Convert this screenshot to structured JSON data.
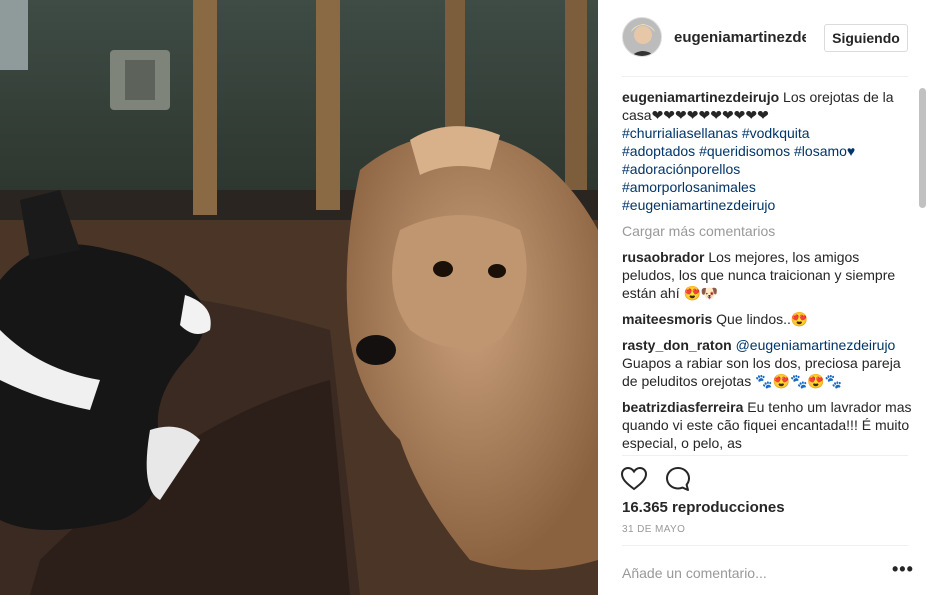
{
  "header": {
    "username": "eugeniamartinezdeirujo",
    "follow_label": "Siguiendo"
  },
  "caption": {
    "username": "eugeniamartinezdeirujo",
    "text": "Los orejotas de la casa❤❤❤❤❤❤❤❤❤❤",
    "hashtags": [
      "#churrialiasellanas #vodkquita",
      "#adoptados #queridisomos #losamo♥",
      "#adoraciónporellos",
      "#amorporlosanimales",
      "#eugeniamartinezdeirujo"
    ]
  },
  "load_more_label": "Cargar más comentarios",
  "comments": [
    {
      "user": "rusaobrador",
      "text": "Los mejores, los amigos peludos, los que nunca traicionan y siempre están ahí 😍🐶"
    },
    {
      "user": "maiteesmoris",
      "text": "Que lindos..😍"
    },
    {
      "user": "rasty_don_raton",
      "mention": "@eugeniamartinezdeirujo",
      "text": " Guapos a rabiar son los dos, preciosa pareja de peluditos orejotas 🐾😍🐾😍🐾"
    },
    {
      "user": "beatrizdiasferreira",
      "text": "Eu tenho um lavrador mas quando vi este cão fiquei encantada!!! É muito especial, o pelo, as"
    }
  ],
  "stats": {
    "views": "16.365 reproducciones",
    "date": "31 DE MAYO"
  },
  "comment_box": {
    "placeholder": "Añade un comentario..."
  },
  "more_label": "•••",
  "icons": {
    "like": "heart-icon",
    "comment": "comment-icon",
    "more": "more-options-icon"
  },
  "colors": {
    "hashtag": "#003569",
    "muted": "#999999",
    "text": "#262626"
  }
}
